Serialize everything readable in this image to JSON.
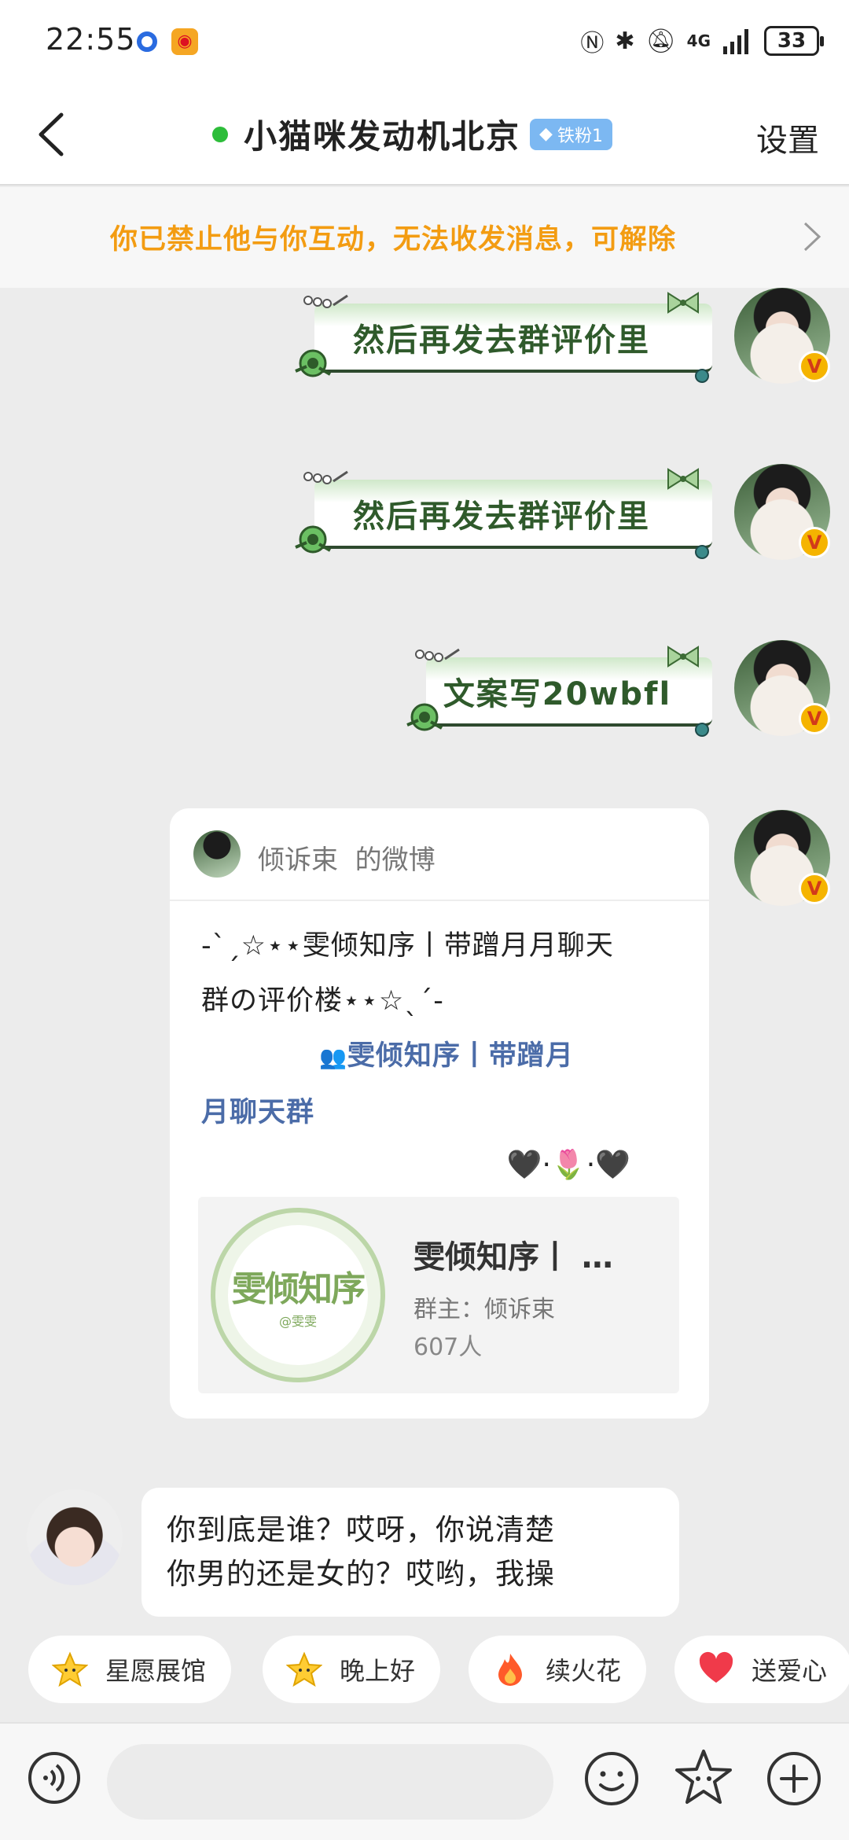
{
  "status_bar": {
    "time": "22:55",
    "battery": "33",
    "network": "4G"
  },
  "header": {
    "title": "小猫咪发动机北京",
    "fan_badge": "铁粉1",
    "settings": "设置"
  },
  "notice": {
    "text": "你已禁止他与你互动，无法收发消息，可解除"
  },
  "messages": [
    {
      "sender": "me",
      "type": "sticker_text",
      "text": "然后再发去群评价里"
    },
    {
      "sender": "me",
      "type": "sticker_text",
      "text": "然后再发去群评价里"
    },
    {
      "sender": "me",
      "type": "sticker_text",
      "text": "文案写20wbfl"
    }
  ],
  "share_card": {
    "author": "倾诉束",
    "suffix": "的微博",
    "line1": "-ˋˏ☆⋆⋆雯倾知序丨带蹭月月聊天",
    "line2": "群の评价楼⋆⋆☆ˎˊ-",
    "link_icon": "👥",
    "link1": "雯倾知序丨带蹭月",
    "link2": "月聊天群",
    "hearts": "🖤·🌷·🖤",
    "group": {
      "logo_text": "雯倾知序",
      "logo_small": "@雯雯",
      "name": "雯倾知序丨 …",
      "owner": "群主：倾诉束",
      "count": "607人"
    }
  },
  "incoming": {
    "line1": "你到底是谁？哎呀，你说清楚",
    "line2": "你男的还是女的？哎哟，我操"
  },
  "quick_replies": [
    {
      "label": "星愿展馆",
      "icon": "star-face-icon"
    },
    {
      "label": "晚上好",
      "icon": "star-face-icon"
    },
    {
      "label": "续火花",
      "icon": "fire-icon"
    },
    {
      "label": "送爱心",
      "icon": "heart-icon"
    }
  ],
  "colors": {
    "notice_text": "#f39c12",
    "online": "#2dbd3a",
    "sticker_text": "#2f5a2b",
    "link": "#4b6ca8",
    "background": "#ececec"
  }
}
